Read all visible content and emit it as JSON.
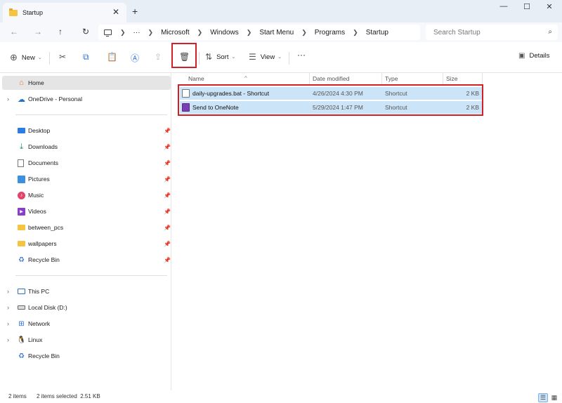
{
  "window": {
    "tab_title": "Startup",
    "tab_close": "✕",
    "new_tab": "+",
    "minimize": "—",
    "maximize": "☐",
    "close": "✕"
  },
  "address": {
    "breadcrumbs": [
      "Microsoft",
      "Windows",
      "Start Menu",
      "Programs",
      "Startup"
    ],
    "more": "···",
    "search_placeholder": "Search Startup"
  },
  "toolbar": {
    "new_label": "New",
    "sort_label": "Sort",
    "view_label": "View",
    "more": "···",
    "details_label": "Details"
  },
  "sidebar": {
    "home": "Home",
    "onedrive": "OneDrive - Personal",
    "quick_access": [
      "Desktop",
      "Downloads",
      "Documents",
      "Pictures",
      "Music",
      "Videos",
      "between_pcs",
      "wallpapers",
      "Recycle Bin"
    ],
    "drives": [
      "This PC",
      "Local Disk (D:)",
      "Network",
      "Linux",
      "Recycle Bin"
    ]
  },
  "columns": {
    "name": "Name",
    "date": "Date modified",
    "type": "Type",
    "size": "Size"
  },
  "files": [
    {
      "name": "daily-upgrades.bat - Shortcut",
      "date": "4/26/2024 4:30 PM",
      "type": "Shortcut",
      "size": "2 KB"
    },
    {
      "name": "Send to OneNote",
      "date": "5/29/2024 1:47 PM",
      "type": "Shortcut",
      "size": "2 KB"
    }
  ],
  "status": {
    "item_count": "2 items",
    "selection": "2 items selected  2.51 KB"
  },
  "colors": {
    "selection": "#cce4f7",
    "highlight_box": "#d0212b",
    "folder": "#f5c542"
  }
}
